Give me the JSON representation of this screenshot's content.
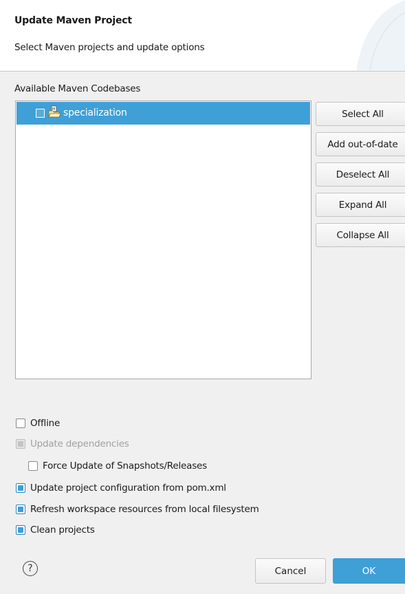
{
  "header": {
    "title": "Update Maven Project",
    "description": "Select Maven projects and update options"
  },
  "codebases": {
    "label": "Available Maven Codebases",
    "items": [
      {
        "name": "specialization",
        "checked": false,
        "selected": true,
        "icon": "maven-project-folder-icon"
      }
    ]
  },
  "side_buttons": {
    "select_all": "Select All",
    "add_out_of_date": "Add out-of-date",
    "deselect_all": "Deselect All",
    "expand_all": "Expand All",
    "collapse_all": "Collapse All"
  },
  "options": {
    "offline": {
      "label": "Offline",
      "checked": false,
      "enabled": true
    },
    "update_dependencies": {
      "label": "Update dependencies",
      "checked": true,
      "enabled": false
    },
    "force_update": {
      "label": "Force Update of Snapshots/Releases",
      "checked": false,
      "enabled": true
    },
    "update_config": {
      "label": "Update project configuration from pom.xml",
      "checked": true,
      "enabled": true
    },
    "refresh_workspace": {
      "label": "Refresh workspace resources from local filesystem",
      "checked": true,
      "enabled": true
    },
    "clean_projects": {
      "label": "Clean projects",
      "checked": true,
      "enabled": true
    }
  },
  "footer": {
    "help_icon": "help-icon",
    "help_glyph": "?",
    "cancel_label": "Cancel",
    "ok_label": "OK"
  },
  "colors": {
    "accent": "#3f9fd7",
    "background": "#f0f0f0",
    "header_background": "#ffffff"
  }
}
